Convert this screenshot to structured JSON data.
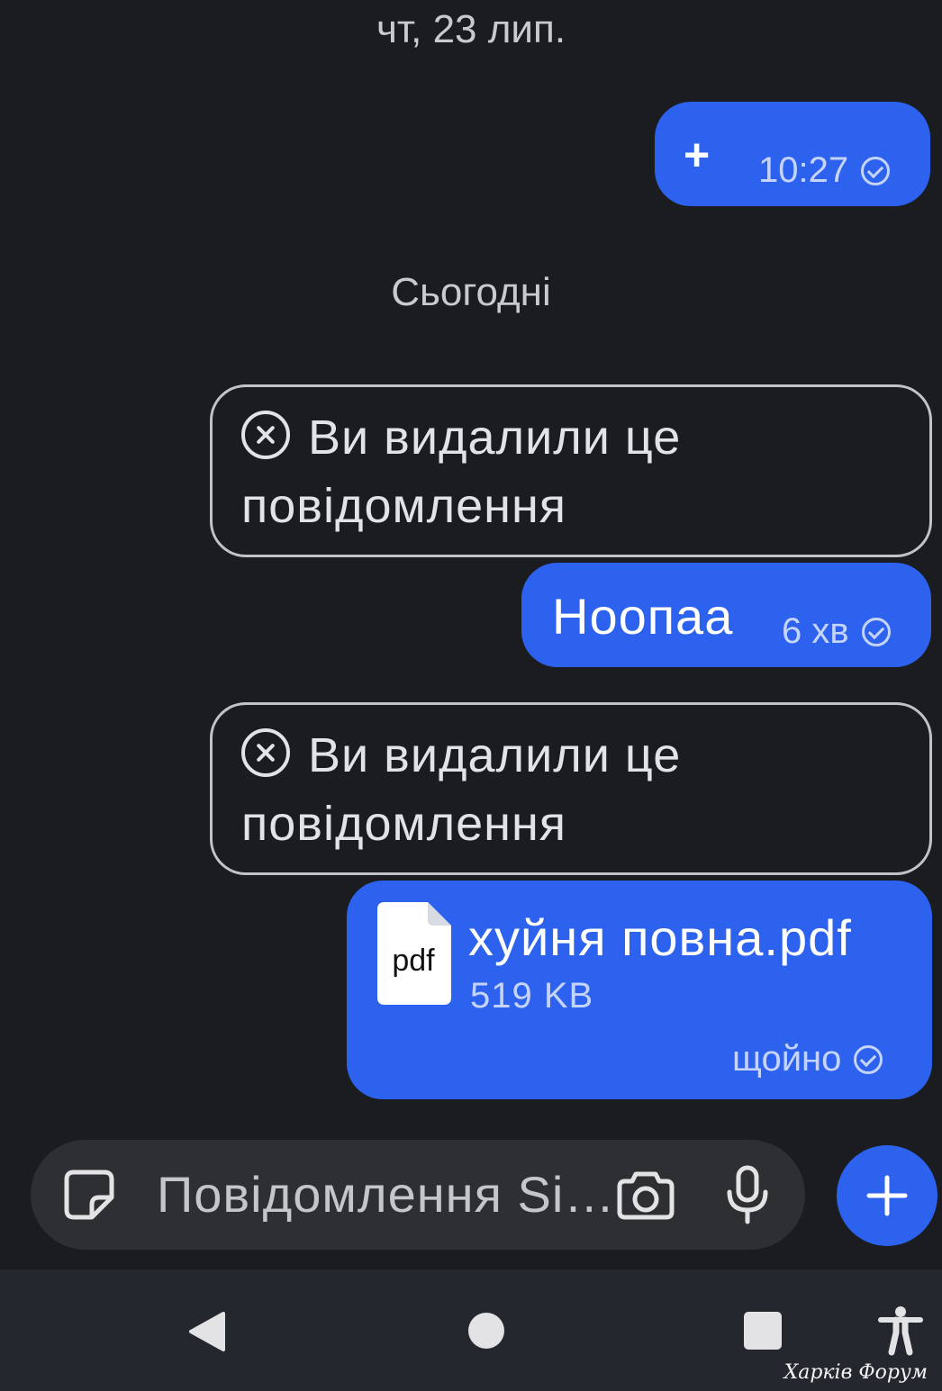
{
  "chat": {
    "date_separator_1": "чт, 23 лип.",
    "date_separator_2": "Сьогодні",
    "messages": [
      {
        "type": "outgoing",
        "text": "+",
        "time": "10:27"
      },
      {
        "type": "deleted",
        "text": "Ви видалили це повідомлення"
      },
      {
        "type": "outgoing",
        "text": "Ноопаа",
        "time": "6 хв"
      },
      {
        "type": "deleted",
        "text": "Ви видалили це повідомлення"
      },
      {
        "type": "file",
        "file_icon_label": "pdf",
        "file_name": "хуйня повна.pdf",
        "file_size": "519 KB",
        "time": "щойно"
      }
    ]
  },
  "composer": {
    "placeholder": "Повідомлення Si…",
    "icons": [
      "sticker-icon",
      "camera-icon",
      "microphone-icon",
      "plus-icon"
    ]
  },
  "navbar": {
    "icons": [
      "back-icon",
      "home-icon",
      "recents-icon",
      "accessibility-icon"
    ]
  },
  "watermark": "Харків Форум",
  "colors": {
    "background": "#1b1c20",
    "bubble": "#2c62ee",
    "composer": "#2e2f33",
    "navbar": "#25272e"
  }
}
